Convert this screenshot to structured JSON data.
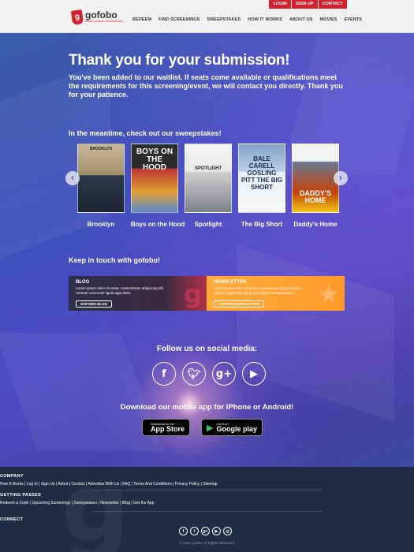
{
  "topbar": {
    "login": "LOGIN",
    "signup": "SIGN UP",
    "contact": "CONTACT"
  },
  "brand": {
    "name": "gofobo",
    "tagline": "Movies. Events. Entertainment."
  },
  "nav": [
    "REDEEM",
    "FIND SCREENINGS",
    "SWEEPSTAKES",
    "HOW IT WORKS",
    "ABOUT US",
    "MOVIES",
    "EVENTS"
  ],
  "hero": {
    "title": "Thank you for your submission!",
    "message": "You've been added to our waitlist. If seats come available or qualifications meet the requirements for this screening/event, we will contact you directly. Thank you for your patience."
  },
  "sweepstakes": {
    "heading": "In the meantime, check out our sweepstakes!",
    "movies": [
      {
        "title": "Brooklyn",
        "poster_text": "BROOKLYN"
      },
      {
        "title": "Boys on the Hood",
        "poster_text": "BOYS ON THE HOOD"
      },
      {
        "title": "Spotlight",
        "poster_text": "SPOTLIGHT"
      },
      {
        "title": "The Big Short",
        "poster_text": "BALE CARELL GOSLING PITT THE BIG SHORT"
      },
      {
        "title": "Daddy's Home",
        "poster_text": "DADDY'S HOME"
      }
    ]
  },
  "keep_in_touch": {
    "heading": "Keep in touch with gofobo!",
    "blog": {
      "title": "BLOG",
      "body": "Lorem ipsum dolor sit amet, consectetuer adipiscing elit. Aenean commodo ligula eget dolor.",
      "button": "GOFOBO BLOG"
    },
    "newsletter": {
      "title": "NEWSLETTER",
      "body": "Lorem ipsum dolor sit amet, consectetuer adipiscing elit. Aenean commodo ligula eget dolor. Aenean massa.",
      "button": "GOFOBO NEWSLETTER"
    }
  },
  "social": {
    "heading": "Follow us on social media:",
    "icons": [
      "facebook-icon",
      "twitter-icon",
      "google-plus-icon",
      "youtube-icon"
    ]
  },
  "apps": {
    "heading": "Download our mobile app for iPhone or Android!",
    "appstore": {
      "small": "Download on the",
      "big": "App Store"
    },
    "googleplay": {
      "small": "Get it on",
      "big": "Google play"
    }
  },
  "footer": {
    "company_heading": "COMPANY",
    "company_links": "How It Works | Log In | Sign Up | About | Contact | Advertise With Us | FAQ | Terms And Conditions | Privacy Policy | Sitemap",
    "passes_heading": "GETTING PASSES",
    "passes_links": "Redeem a Code | Upcoming Screenings | Sweepstakes | Newsletter | Blog | Get the App",
    "connect_heading": "CONNECT",
    "copyright": "© 2015 gofobo All Rights Reserved."
  },
  "colors": {
    "brand_red": "#d3202f",
    "footer_bg": "#1f2d45",
    "newsletter_orange": "#ff9f30"
  }
}
